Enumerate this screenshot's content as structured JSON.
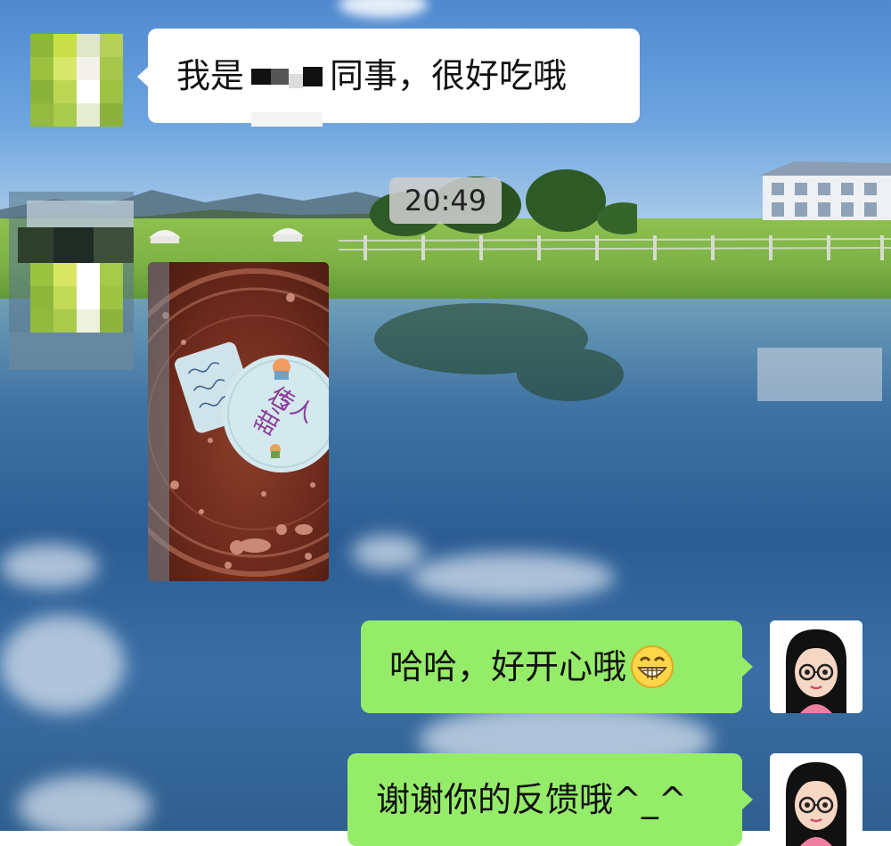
{
  "chat": {
    "timestamp": "20:49",
    "messages": [
      {
        "side": "left",
        "type": "text",
        "text_before": "我是",
        "text_after": "同事，很好吃哦"
      },
      {
        "side": "left",
        "type": "image",
        "image_label_round": "甜心",
        "image_label_round_2": "传人"
      },
      {
        "side": "right",
        "type": "text",
        "text": "哈哈，好开心哦",
        "emoji": "grinning-face-icon"
      },
      {
        "side": "right",
        "type": "text",
        "text": "谢谢你的反馈哦^_^"
      }
    ]
  },
  "colors": {
    "incoming_bubble": "#ffffff",
    "outgoing_bubble": "#95ec69",
    "timestamp_bg": "#cdcdcd"
  }
}
